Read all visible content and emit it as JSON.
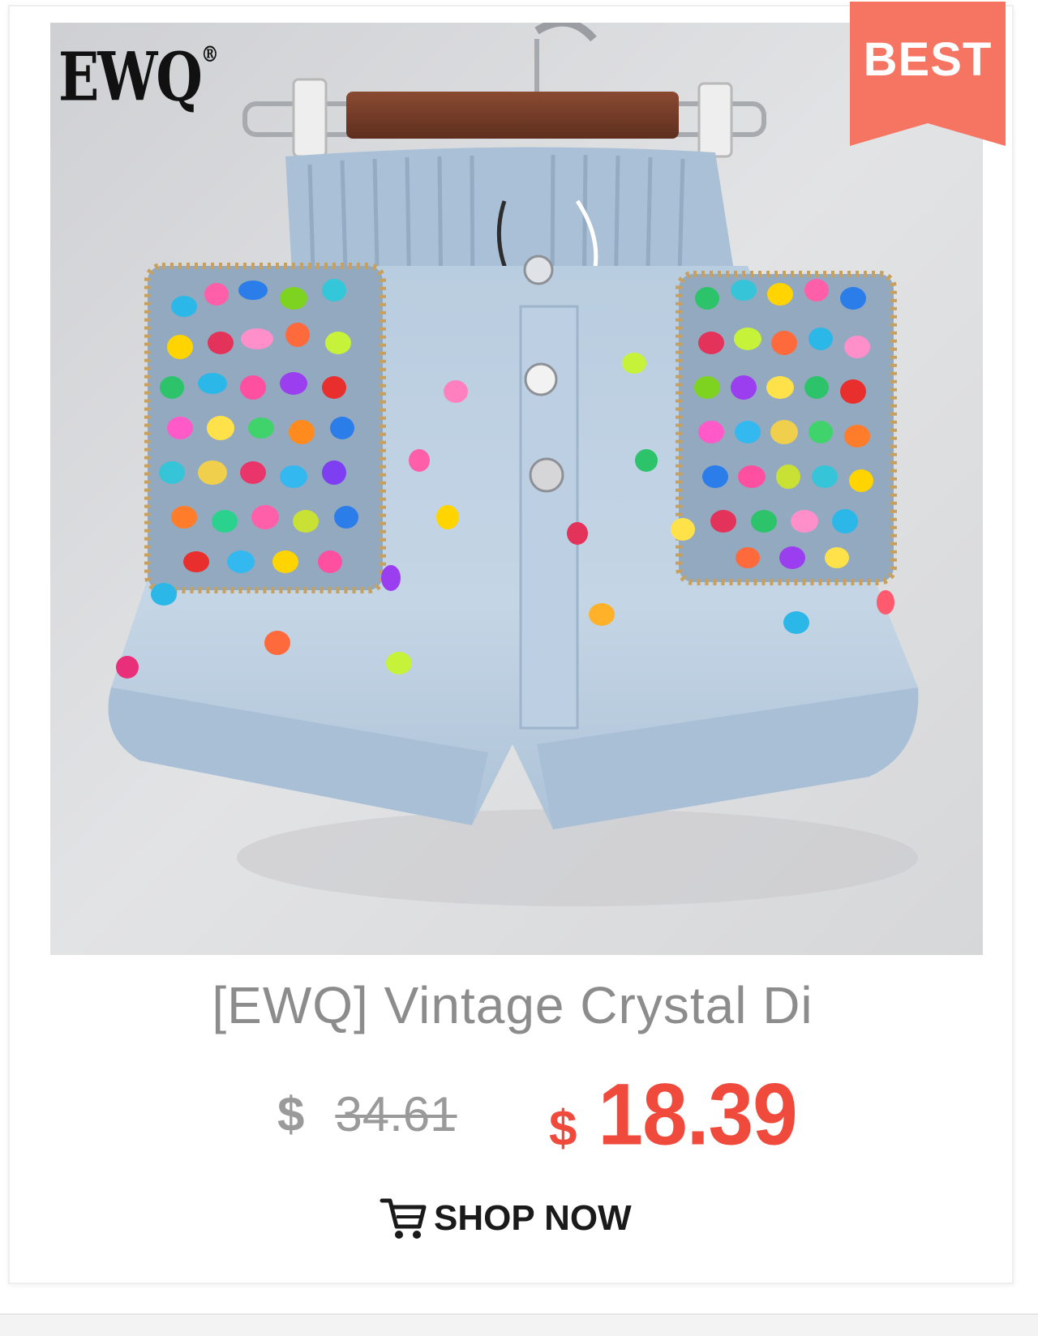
{
  "product": {
    "brand_logo": "EWQ",
    "brand_mark": "®",
    "badge": "BEST",
    "title": "[EWQ] Vintage Crystal Di",
    "original_price": {
      "currency": "$",
      "amount": "34.61"
    },
    "sale_price": {
      "currency": "$",
      "amount": "18.39"
    },
    "cta_label": "SHOP NOW"
  },
  "icons": {
    "cart": "shopping-cart-icon"
  },
  "colors": {
    "badge": "#f57462",
    "sale_price": "#ef4a3c",
    "old_price": "#9a9a9a",
    "title": "#8c8c8c"
  }
}
